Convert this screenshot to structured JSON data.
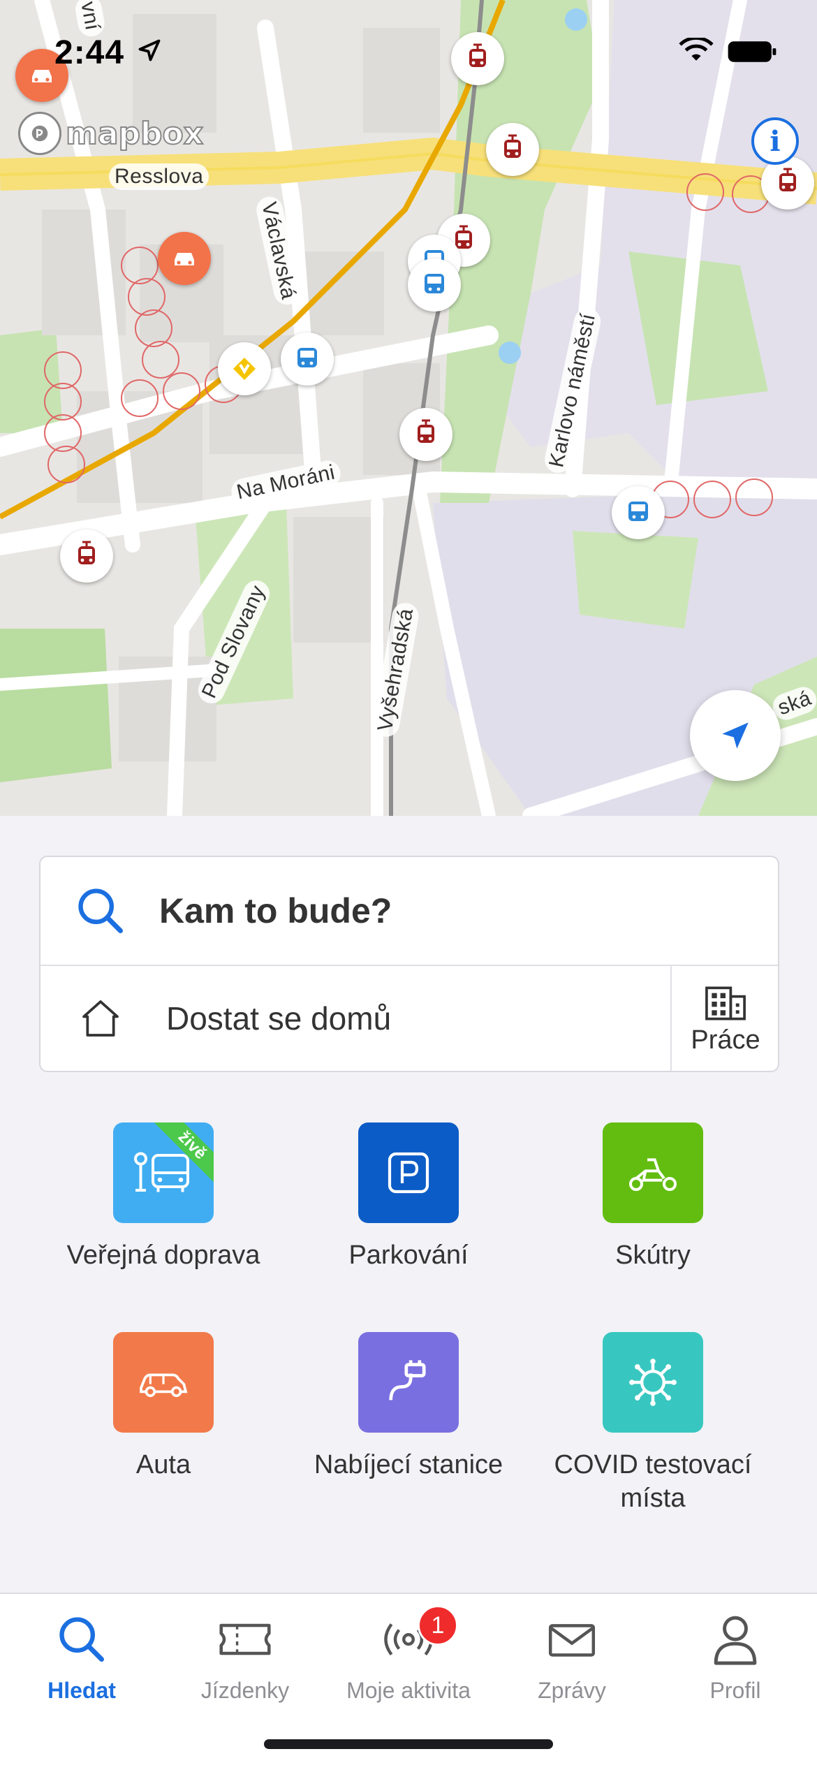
{
  "status_bar": {
    "time": "2:44"
  },
  "map": {
    "attribution": "mapbox",
    "street_labels": [
      "Resslova",
      "Václavská",
      "Na Moráni",
      "Karlovo náměstí",
      "Pod Slovany",
      "Vyšehradská",
      "ská",
      "vní"
    ],
    "info_icon": "i"
  },
  "search": {
    "placeholder": "Kam to bude?",
    "home_label": "Dostat se domů",
    "work_label": "Práce"
  },
  "categories": [
    {
      "label": "Veřejná doprava",
      "color": "#40adf2",
      "badge": "živě",
      "icon": "bus-stop-icon"
    },
    {
      "label": "Parkování",
      "color": "#0b5cc6",
      "icon": "parking-icon"
    },
    {
      "label": "Skútry",
      "color": "#63bd11",
      "icon": "scooter-icon"
    },
    {
      "label": "Auta",
      "color": "#f27a4a",
      "icon": "car-icon"
    },
    {
      "label": "Nabíjecí stanice",
      "color": "#7a6fe0",
      "icon": "charging-plug-icon"
    },
    {
      "label": "COVID testovací místa",
      "color": "#38c7c0",
      "icon": "virus-icon"
    }
  ],
  "tabs": [
    {
      "label": "Hledat",
      "active": true,
      "icon": "search-icon"
    },
    {
      "label": "Jízdenky",
      "active": false,
      "icon": "ticket-icon"
    },
    {
      "label": "Moje aktivita",
      "active": false,
      "icon": "broadcast-icon",
      "badge": "1"
    },
    {
      "label": "Zprávy",
      "active": false,
      "icon": "mail-icon"
    },
    {
      "label": "Profil",
      "active": false,
      "icon": "profile-icon"
    }
  ]
}
